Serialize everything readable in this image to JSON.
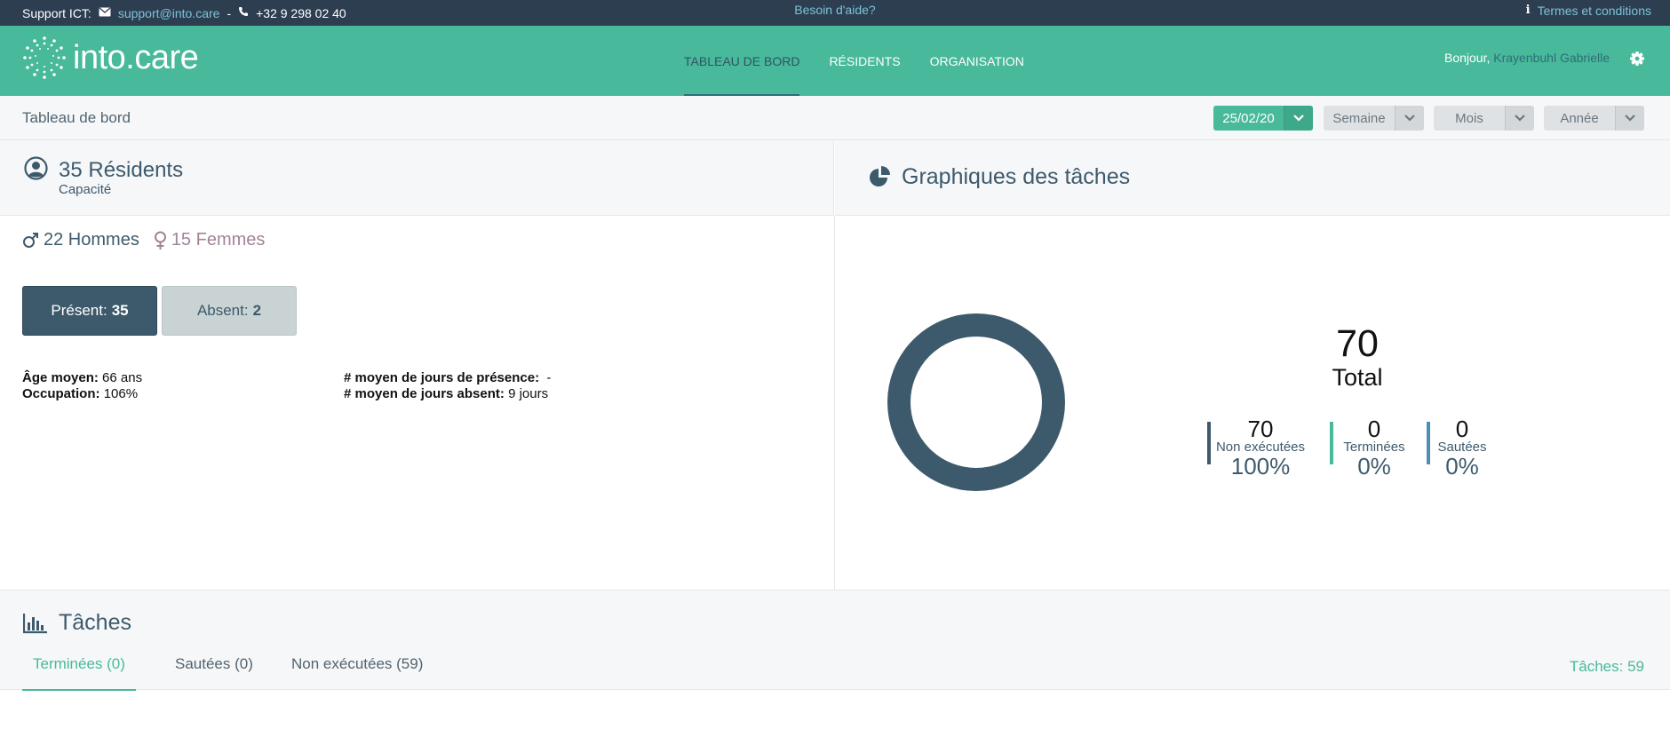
{
  "topbar": {
    "support_label": "Support ICT:",
    "email": "support@into.care",
    "separator": "-",
    "phone": "+32 9 298 02 40",
    "help": "Besoin d'aide?",
    "terms": "Termes et conditions"
  },
  "header": {
    "logo_text": "into.care",
    "nav": [
      {
        "label": "TABLEAU DE BORD",
        "active": true
      },
      {
        "label": "RÉSIDENTS",
        "active": false
      },
      {
        "label": "ORGANISATION",
        "active": false
      }
    ],
    "greeting": "Bonjour,",
    "user_name": "Krayenbuhl Gabrielle"
  },
  "subheader": {
    "breadcrumb": "Tableau de bord",
    "date": "25/02/20",
    "periods": [
      "Semaine",
      "Mois",
      "Année"
    ]
  },
  "residents": {
    "title": "35 Résidents",
    "subtitle": "Capacité",
    "men": "22 Hommes",
    "women": "15 Femmes",
    "present_label": "Présent:",
    "present_value": "35",
    "absent_label": "Absent:",
    "absent_value": "2",
    "avg_age_label": "Âge moyen:",
    "avg_age_value": "66 ans",
    "occupation_label": "Occupation:",
    "occupation_value": "106%",
    "avg_presence_label": "# moyen de jours de présence:",
    "avg_presence_value": "-",
    "avg_absent_label": "# moyen de jours absent:",
    "avg_absent_value": "9 jours"
  },
  "graph": {
    "title": "Graphiques des tâches",
    "total_value": "70",
    "total_label": "Total",
    "kpis": [
      {
        "value": "70",
        "label": "Non exécutées",
        "percent": "100%",
        "color": "#3d5a6c"
      },
      {
        "value": "0",
        "label": "Terminées",
        "percent": "0%",
        "color": "#48b99b"
      },
      {
        "value": "0",
        "label": "Sautées",
        "percent": "0%",
        "color": "#4a8db5"
      }
    ]
  },
  "chart_data": {
    "type": "pie",
    "categories": [
      "Non exécutées",
      "Terminées",
      "Sautées"
    ],
    "values": [
      70,
      0,
      0
    ],
    "colors": [
      "#3d5a6c",
      "#48b99b",
      "#4a8db5"
    ]
  },
  "tasks": {
    "title": "Tâches",
    "tabs": [
      {
        "label": "Terminées (0)",
        "active": true
      },
      {
        "label": "Sautées (0)",
        "active": false
      },
      {
        "label": "Non exécutées (59)",
        "active": false
      }
    ],
    "count": "Tâches: 59"
  },
  "colors": {
    "brand": "#48b99b",
    "dark": "#3d5a6c",
    "topbar": "#2d3e50"
  }
}
